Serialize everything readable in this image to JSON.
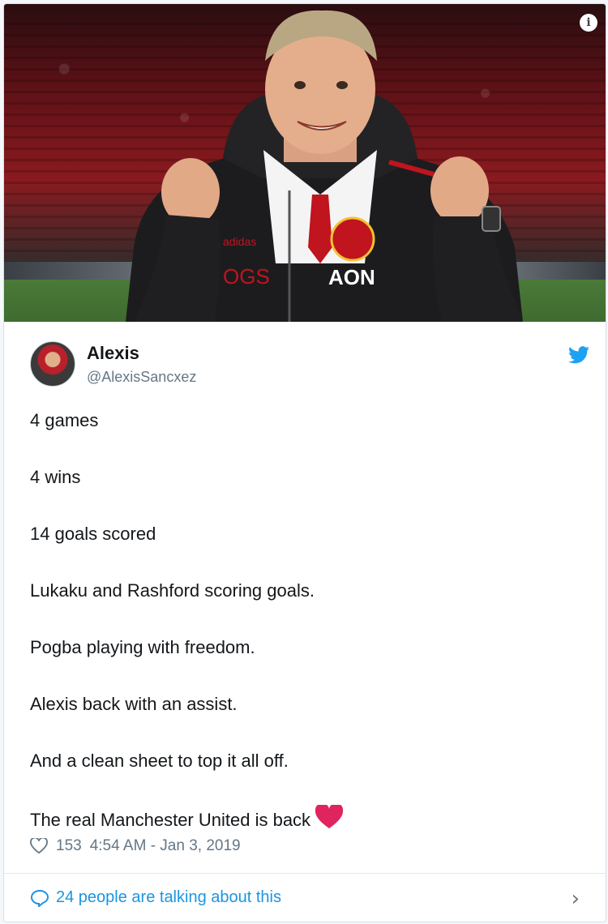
{
  "image": {
    "alt_icon": "info-icon",
    "info_glyph": "i",
    "badge_text": "OGS",
    "sponsor_text": "AON",
    "brand_text": "adidas"
  },
  "tweet": {
    "author_name": "Alexis",
    "author_handle": "@AlexisSancxez",
    "lines": [
      "4 games",
      "4 wins",
      "14 goals scored",
      "Lukaku and Rashford scoring goals.",
      "Pogba playing with freedom.",
      "Alexis back with an assist.",
      "And a clean sheet to top it all off.",
      "The real Manchester United is back"
    ],
    "likes": "153",
    "timestamp": "4:54 AM - Jan 3, 2019"
  },
  "footer": {
    "talking_text": "24 people are talking about this",
    "chevron": "›"
  },
  "colors": {
    "twitter_blue": "#1da1f2",
    "link_blue": "#1b95e0",
    "heart_red": "#e0245e",
    "muted": "#657786"
  }
}
